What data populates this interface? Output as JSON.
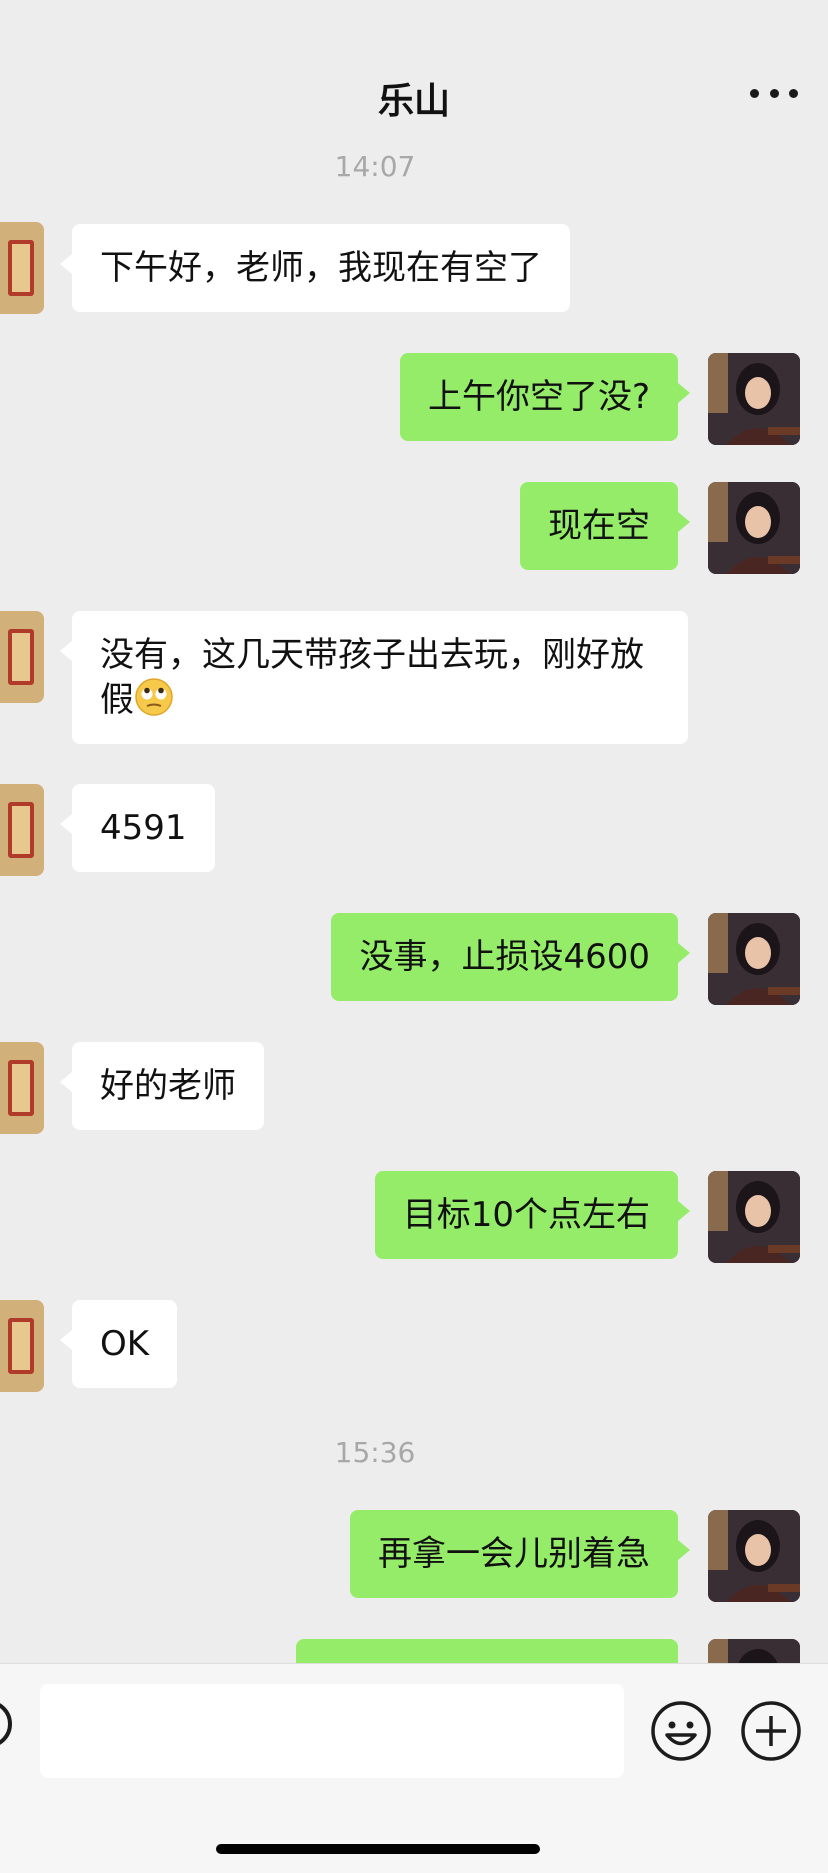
{
  "header": {
    "title": "乐山"
  },
  "messages": [
    {
      "type": "time",
      "text": "14:07"
    },
    {
      "type": "in",
      "text": "下午好，老师，我现在有空了"
    },
    {
      "type": "out",
      "text": "上午你空了没?"
    },
    {
      "type": "out",
      "text": "现在空"
    },
    {
      "type": "in",
      "text": "没有，这几天带孩子出去玩，刚好放假",
      "emoji": "rolling-eyes-emoji"
    },
    {
      "type": "in",
      "text": "4591"
    },
    {
      "type": "out",
      "text": "没事，止损设4600"
    },
    {
      "type": "in",
      "text": "好的老师"
    },
    {
      "type": "out",
      "text": "目标10个点左右"
    },
    {
      "type": "in",
      "text": "OK"
    },
    {
      "type": "time",
      "text": "15:36"
    },
    {
      "type": "out",
      "text": "再拿一会儿别着急"
    },
    {
      "type": "out",
      "text": ""
    }
  ],
  "input": {
    "value": "",
    "placeholder": ""
  },
  "icons": {
    "more": "more-dots-icon",
    "voice": "voice-icon",
    "emoji": "emoji-icon",
    "plus": "plus-icon"
  },
  "colors": {
    "background": "#ededed",
    "incoming_bubble": "#ffffff",
    "outgoing_bubble": "#95ec69",
    "timestamp": "#a8a8a8"
  }
}
